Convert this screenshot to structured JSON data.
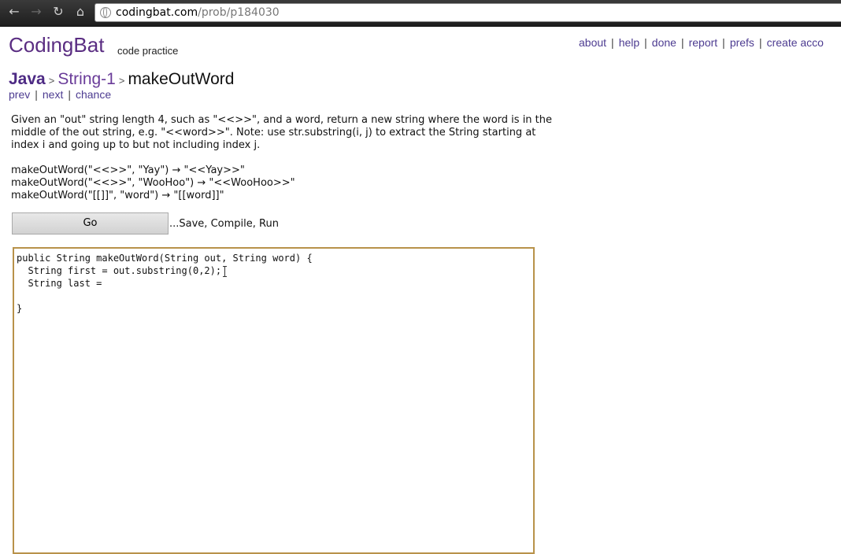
{
  "browser": {
    "url_host": "codingbat.com",
    "url_path": "/prob/p184030"
  },
  "header": {
    "logo": "CodingBat",
    "tagline": "code practice",
    "links": [
      "about",
      "help",
      "done",
      "report",
      "prefs",
      "create acco"
    ]
  },
  "breadcrumb": {
    "language": "Java",
    "section": "String-1",
    "problem": "makeOutWord",
    "arrow": ">"
  },
  "nav": {
    "prev": "prev",
    "next": "next",
    "chance": "chance",
    "separator": "|"
  },
  "problem": {
    "description": "Given an \"out\" string length 4, such as \"<<>>\", and a word, return a new string where the word is in the middle of the out string, e.g. \"<<word>>\". Note: use str.substring(i, j) to extract the String starting at index i and going up to but not including index j.",
    "examples": [
      "makeOutWord(\"<<>>\", \"Yay\") → \"<<Yay>>\"",
      "makeOutWord(\"<<>>\", \"WooHoo\") → \"<<WooHoo>>\"",
      "makeOutWord(\"[[]]\", \"word\") → \"[[word]]\""
    ]
  },
  "controls": {
    "go_label": "Go",
    "go_hint": "...Save, Compile, Run"
  },
  "editor": {
    "code": "public String makeOutWord(String out, String word) {\n  String first = out.substring(0,2);\n  String last = \n\n}"
  }
}
